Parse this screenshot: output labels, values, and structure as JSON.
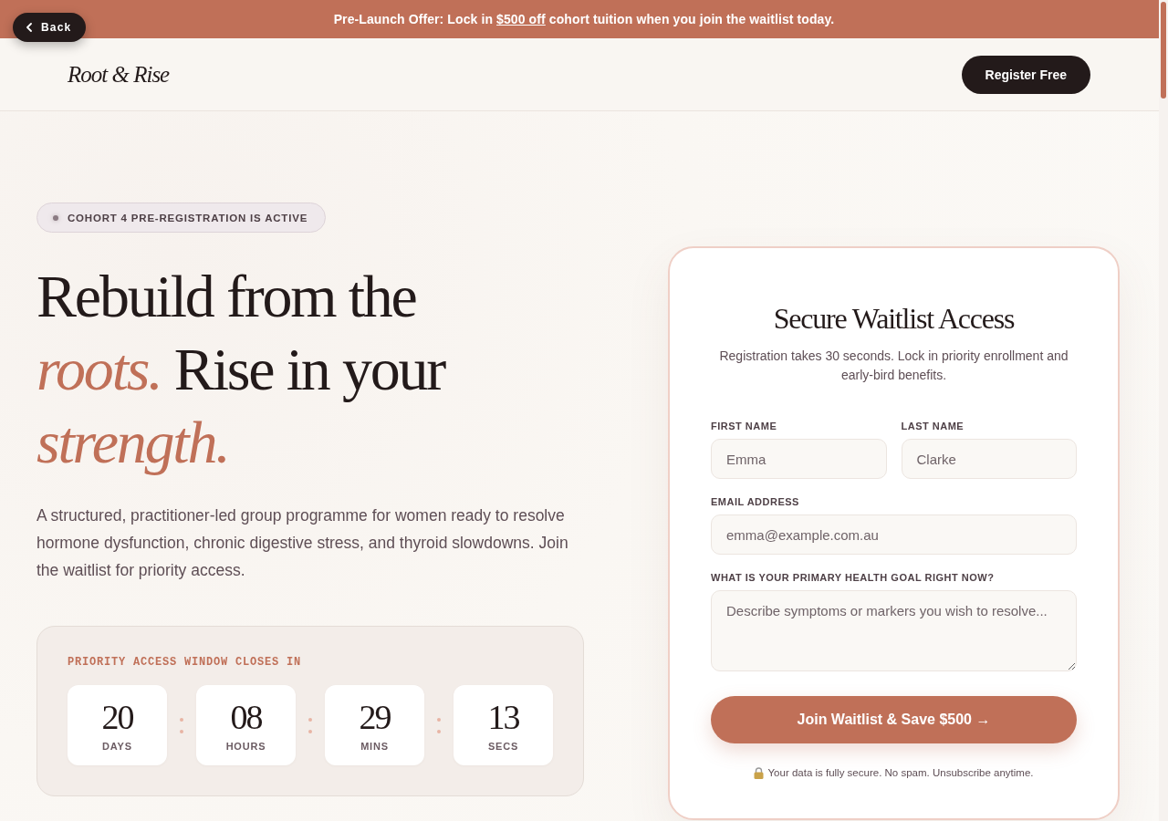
{
  "back_button": {
    "label": "Back"
  },
  "promo_banner": {
    "text_before": "Pre-Launch Offer: Lock in",
    "link": "$500 off",
    "text_after": "cohort tuition when you join the waitlist today."
  },
  "header": {
    "logo": "Root & Rise",
    "cta_button": "Register Free"
  },
  "hero": {
    "badge": "COHORT 4 PRE-REGISTRATION IS ACTIVE",
    "heading_lines": [
      "Rebuild from the",
      "*roots.* Rise in your",
      "*strength.*"
    ],
    "description": "A structured, practitioner-led group programme for women ready to resolve hormone dysfunction, chronic digestive stress, and thyroid slowdowns. Join the waitlist for priority access.",
    "countdown": {
      "title": "PRIORITY ACCESS WINDOW CLOSES IN",
      "units": [
        {
          "value": "20",
          "label": "DAYS"
        },
        {
          "value": "08",
          "label": "HOURS"
        },
        {
          "value": "29",
          "label": "MINS"
        },
        {
          "value": "13",
          "label": "SECS"
        }
      ]
    }
  },
  "signup_card": {
    "title": "Secure Waitlist Access",
    "subtitle": "Registration takes 30 seconds. Lock in priority enrollment and early-bird benefits.",
    "field_rows": [
      [
        {
          "kind": "input",
          "label": "FIRST NAME",
          "placeholder": "Emma"
        },
        {
          "kind": "input",
          "label": "LAST NAME",
          "placeholder": "Clarke"
        }
      ],
      [
        {
          "kind": "input",
          "label": "EMAIL ADDRESS",
          "placeholder": "emma@example.com.au"
        }
      ],
      [
        {
          "kind": "textarea",
          "label": "WHAT IS YOUR PRIMARY HEALTH GOAL RIGHT NOW?",
          "placeholder": "Describe symptoms or markers you wish to resolve..."
        }
      ]
    ],
    "submit_button": "Join Waitlist & Save $500 →",
    "privacy_note": "Your data is fully secure. No spam. Unsubscribe anytime."
  }
}
